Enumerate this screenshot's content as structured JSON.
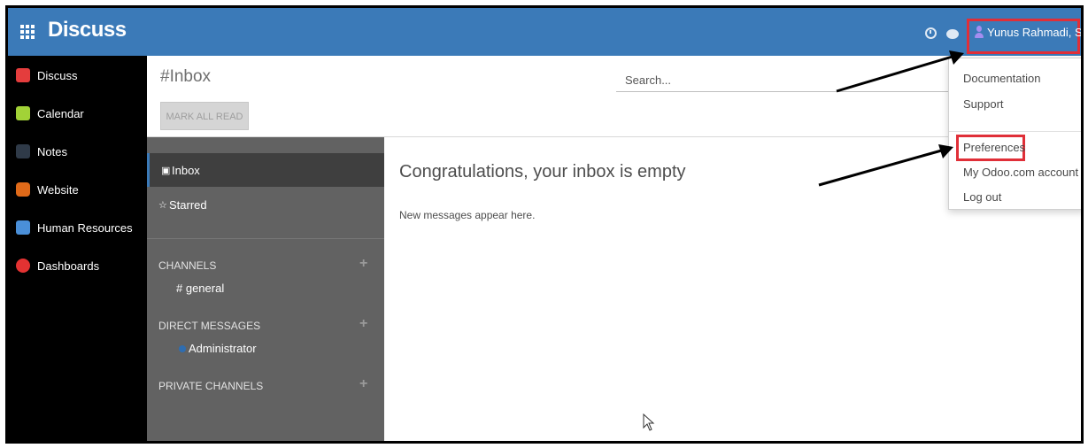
{
  "topbar": {
    "title": "Discuss",
    "user_name": "Yunus Rahmadi, ST"
  },
  "app_menu": [
    {
      "label": "Discuss",
      "icon": "speech-bubble-icon",
      "color": "#e43d3d"
    },
    {
      "label": "Calendar",
      "icon": "calendar-icon",
      "color": "#a2d237"
    },
    {
      "label": "Notes",
      "icon": "notes-icon",
      "color": "#2f3a48"
    },
    {
      "label": "Website",
      "icon": "globe-icon",
      "color": "#e06a19"
    },
    {
      "label": "Human Resources",
      "icon": "people-icon",
      "color": "#4a8fd8"
    },
    {
      "label": "Dashboards",
      "icon": "gauge-icon",
      "color": "#e33232"
    }
  ],
  "control": {
    "page_title": "#Inbox",
    "mark_all_read": "MARK ALL READ",
    "search_placeholder": "Search..."
  },
  "sidebar": {
    "inbox": "Inbox",
    "starred": "Starred",
    "channels_head": "CHANNELS",
    "channel_general": "# general",
    "dm_head": "DIRECT MESSAGES",
    "dm_admin": "Administrator",
    "private_head": "PRIVATE CHANNELS"
  },
  "content": {
    "empty_title": "Congratulations, your inbox is empty",
    "empty_sub": "New messages appear here."
  },
  "dropdown": {
    "documentation": "Documentation",
    "support": "Support",
    "preferences": "Preferences",
    "odoo_account": "My Odoo.com account",
    "logout": "Log out"
  }
}
